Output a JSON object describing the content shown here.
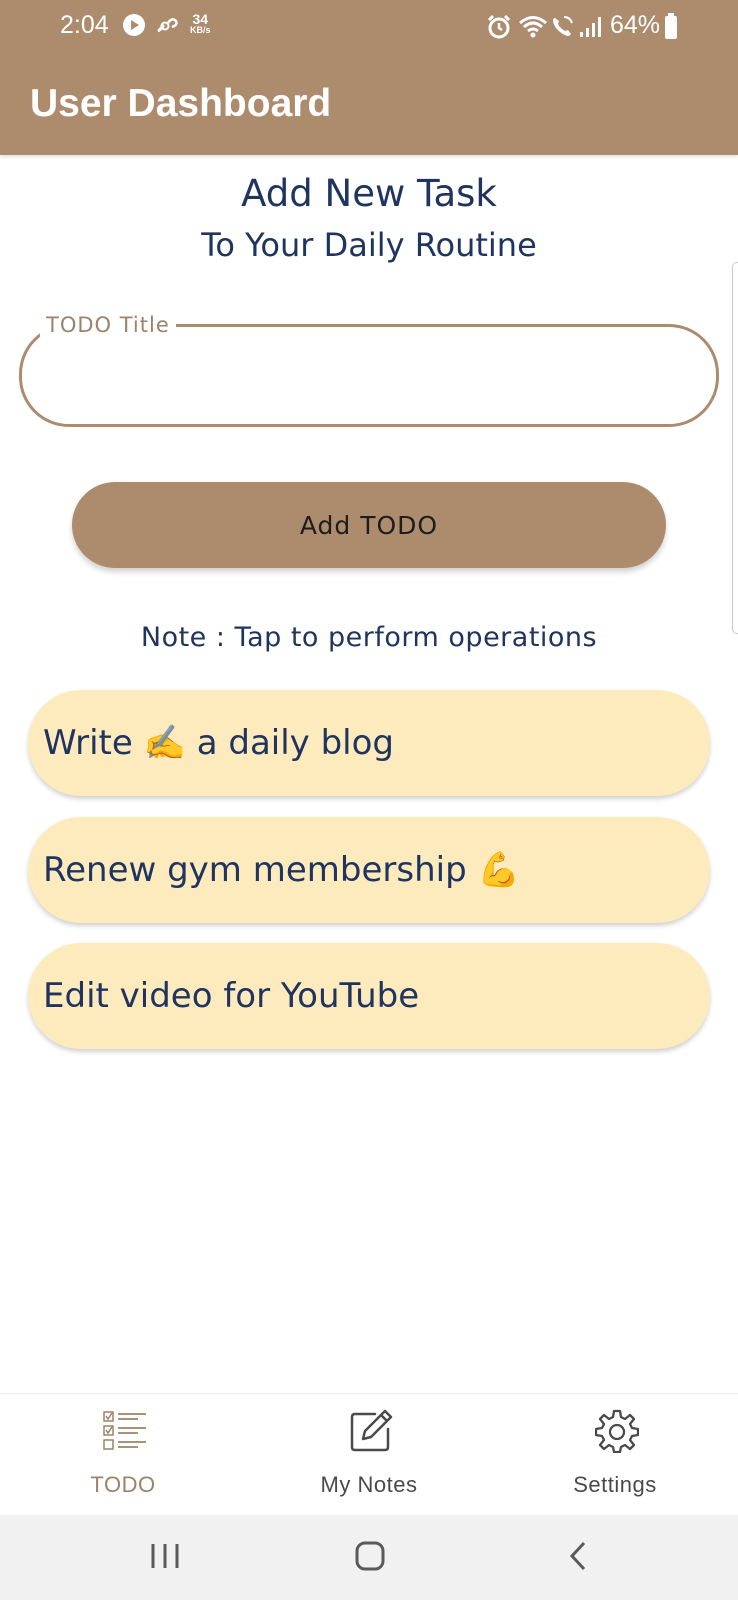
{
  "status_bar": {
    "time": "2:04",
    "net_speed_value": "34",
    "net_speed_unit": "KB/s",
    "battery": "64%",
    "icons": [
      "play-icon",
      "link-icon",
      "alarm-icon",
      "wifi-icon",
      "wifi-calling-icon",
      "signal-icon",
      "battery-icon"
    ]
  },
  "app_bar": {
    "title": "User Dashboard"
  },
  "form": {
    "heading_line1": "Add New Task",
    "heading_line2": "To Your Daily Routine",
    "field_label": "TODO Title",
    "field_value": "",
    "add_button_label": "Add TODO",
    "note": "Note : Tap to perform operations"
  },
  "tasks": [
    {
      "text": "Write ✍️ a daily blog"
    },
    {
      "text": "Renew gym membership 💪"
    },
    {
      "text": "Edit video for YouTube"
    }
  ],
  "bottom_nav": {
    "items": [
      {
        "label": "TODO",
        "icon": "checklist-icon",
        "active": true
      },
      {
        "label": "My Notes",
        "icon": "edit-note-icon",
        "active": false
      },
      {
        "label": "Settings",
        "icon": "gear-icon",
        "active": false
      }
    ]
  },
  "system_nav": {
    "icons": [
      "recents-icon",
      "home-icon",
      "back-icon"
    ]
  },
  "colors": {
    "brand": "#ad8c6e",
    "heading_text": "#1f3560",
    "task_card": "#fdebbd",
    "active_nav": "#9c8268",
    "inactive_nav": "#4a4a4a"
  }
}
